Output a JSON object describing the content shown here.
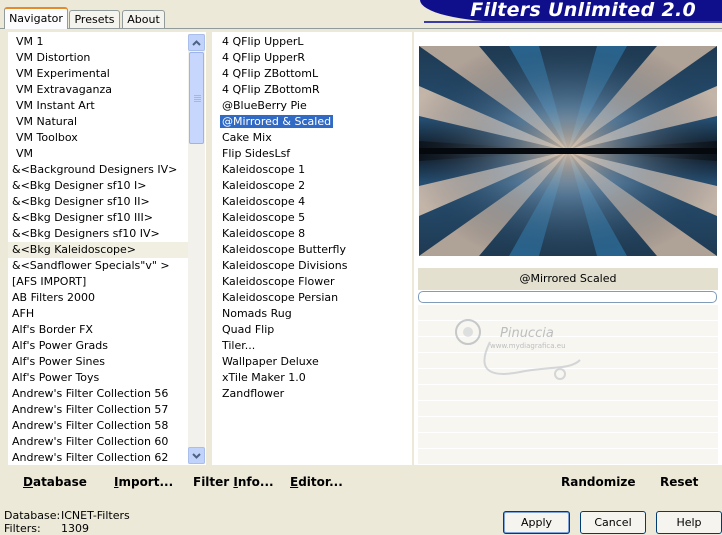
{
  "tabs": [
    "Navigator",
    "Presets",
    "About"
  ],
  "brand_title": "Filters Unlimited 2.0",
  "categories": [
    {
      "label": "VM 1",
      "indent": true
    },
    {
      "label": "VM Distortion",
      "indent": true
    },
    {
      "label": "VM Experimental",
      "indent": true
    },
    {
      "label": "VM Extravaganza",
      "indent": true
    },
    {
      "label": "VM Instant Art",
      "indent": true
    },
    {
      "label": "VM Natural",
      "indent": true
    },
    {
      "label": "VM Toolbox",
      "indent": true
    },
    {
      "label": "VM",
      "indent": true
    },
    {
      "label": "&<Background Designers IV>"
    },
    {
      "label": "&<Bkg Designer sf10 I>"
    },
    {
      "label": "&<Bkg Designer sf10 II>"
    },
    {
      "label": "&<Bkg Designer sf10 III>"
    },
    {
      "label": "&<Bkg Designers sf10 IV>"
    },
    {
      "label": "&<Bkg Kaleidoscope>",
      "selected": true
    },
    {
      "label": "&<Sandflower Specials\"v\" >"
    },
    {
      "label": "[AFS IMPORT]"
    },
    {
      "label": "AB Filters 2000"
    },
    {
      "label": "AFH"
    },
    {
      "label": "Alf's Border FX"
    },
    {
      "label": "Alf's Power Grads"
    },
    {
      "label": "Alf's Power Sines"
    },
    {
      "label": "Alf's Power Toys"
    },
    {
      "label": "Andrew's Filter Collection 56"
    },
    {
      "label": "Andrew's Filter Collection 57"
    },
    {
      "label": "Andrew's Filter Collection 58"
    },
    {
      "label": "Andrew's Filter Collection 60"
    },
    {
      "label": "Andrew's Filter Collection 62"
    }
  ],
  "filters": [
    {
      "label": "4 QFlip UpperL"
    },
    {
      "label": "4 QFlip UpperR"
    },
    {
      "label": "4 QFlip ZBottomL"
    },
    {
      "label": "4 QFlip ZBottomR"
    },
    {
      "label": "@BlueBerry Pie"
    },
    {
      "label": "@Mirrored & Scaled",
      "selected": true
    },
    {
      "label": "Cake Mix"
    },
    {
      "label": "Flip SidesLsf"
    },
    {
      "label": "Kaleidoscope 1"
    },
    {
      "label": "Kaleidoscope 2"
    },
    {
      "label": "Kaleidoscope 4"
    },
    {
      "label": "Kaleidoscope 5"
    },
    {
      "label": "Kaleidoscope 8"
    },
    {
      "label": "Kaleidoscope Butterfly"
    },
    {
      "label": "Kaleidoscope Divisions"
    },
    {
      "label": "Kaleidoscope Flower"
    },
    {
      "label": "Kaleidoscope Persian"
    },
    {
      "label": "Nomads Rug"
    },
    {
      "label": "Quad Flip"
    },
    {
      "label": "Tiler..."
    },
    {
      "label": "Wallpaper Deluxe"
    },
    {
      "label": "xTile Maker 1.0"
    },
    {
      "label": "Zandflower"
    }
  ],
  "preview": {
    "filter_name": "@Mirrored  Scaled"
  },
  "watermark": {
    "name": "Pinuccia",
    "site": "www.mydiagrafica.eu"
  },
  "links": {
    "database": {
      "pre": "",
      "u": "D",
      "post": "atabase"
    },
    "import": {
      "pre": "",
      "u": "I",
      "post": "mport..."
    },
    "filter_info": {
      "pre": "Filter ",
      "u": "I",
      "post": "nfo..."
    },
    "editor": {
      "pre": "",
      "u": "E",
      "post": "ditor..."
    },
    "randomize": "Randomize",
    "reset": "Reset"
  },
  "status": {
    "database_label": "Database:",
    "database_value": "ICNET-Filters",
    "filters_label": "Filters:",
    "filters_value": "1309"
  },
  "buttons": {
    "apply": "Apply",
    "cancel": "Cancel",
    "help": "Help"
  },
  "colors": {
    "selection": "#316AC5",
    "brand": "#0F0F8C",
    "tab_accent": "#E68B2C"
  }
}
